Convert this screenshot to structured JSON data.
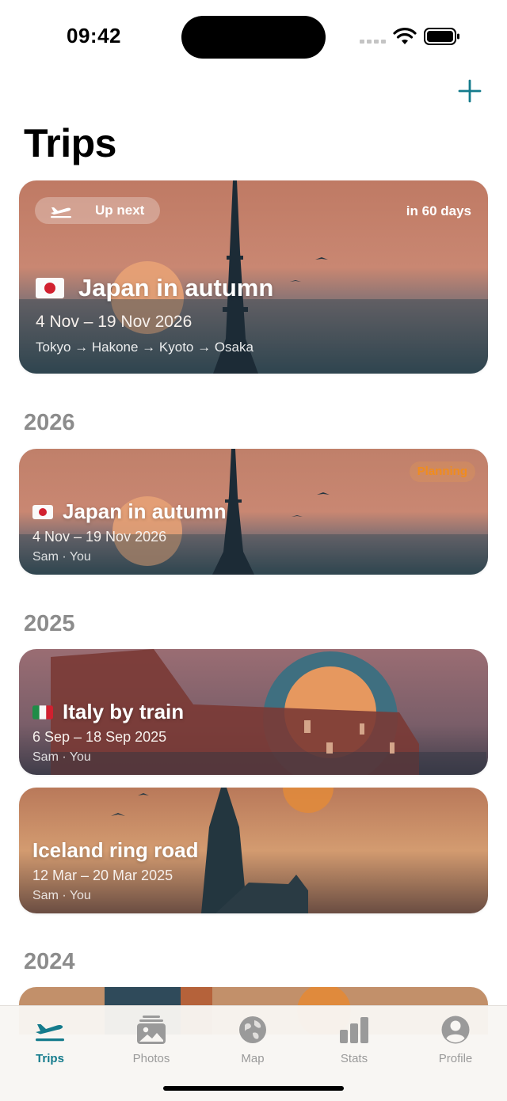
{
  "status_bar": {
    "time": "09:42"
  },
  "header": {
    "title": "Trips",
    "add_icon": "plus-icon"
  },
  "featured": {
    "badge": "Up next",
    "badge_icon": "airplane-takeoff-icon",
    "countdown": "in 60 days",
    "flag": "japan-flag",
    "title": "Japan in autumn",
    "dates": "4 Nov – 19 Nov 2026",
    "route": "Tokyo → Hakone → Kyoto → Osaka"
  },
  "sections": [
    {
      "year": "2026",
      "trips": [
        {
          "flag": "japan-flag",
          "title": "Japan in autumn",
          "dates": "4 Nov – 19 Nov 2026",
          "people": "Sam · You",
          "status": "Planning"
        }
      ]
    },
    {
      "year": "2025",
      "trips": [
        {
          "flag": "italy-flag",
          "title": "Italy by train",
          "dates": "6 Sep – 18 Sep 2025",
          "people": "Sam · You"
        },
        {
          "title": "Iceland ring road",
          "dates": "12 Mar – 20 Mar 2025",
          "people": "Sam · You"
        }
      ]
    },
    {
      "year": "2024",
      "trips": []
    }
  ],
  "tab_bar": {
    "tabs": [
      {
        "label": "Trips",
        "icon": "airplane-icon",
        "active": true
      },
      {
        "label": "Photos",
        "icon": "photos-icon"
      },
      {
        "label": "Map",
        "icon": "globe-icon"
      },
      {
        "label": "Stats",
        "icon": "bar-chart-icon"
      },
      {
        "label": "Profile",
        "icon": "person-icon"
      }
    ]
  },
  "colors": {
    "accent": "#147b8c",
    "planning": "#f08c1e",
    "inactive_tab": "#9a9a9a",
    "year_header": "#8c8c8c"
  }
}
